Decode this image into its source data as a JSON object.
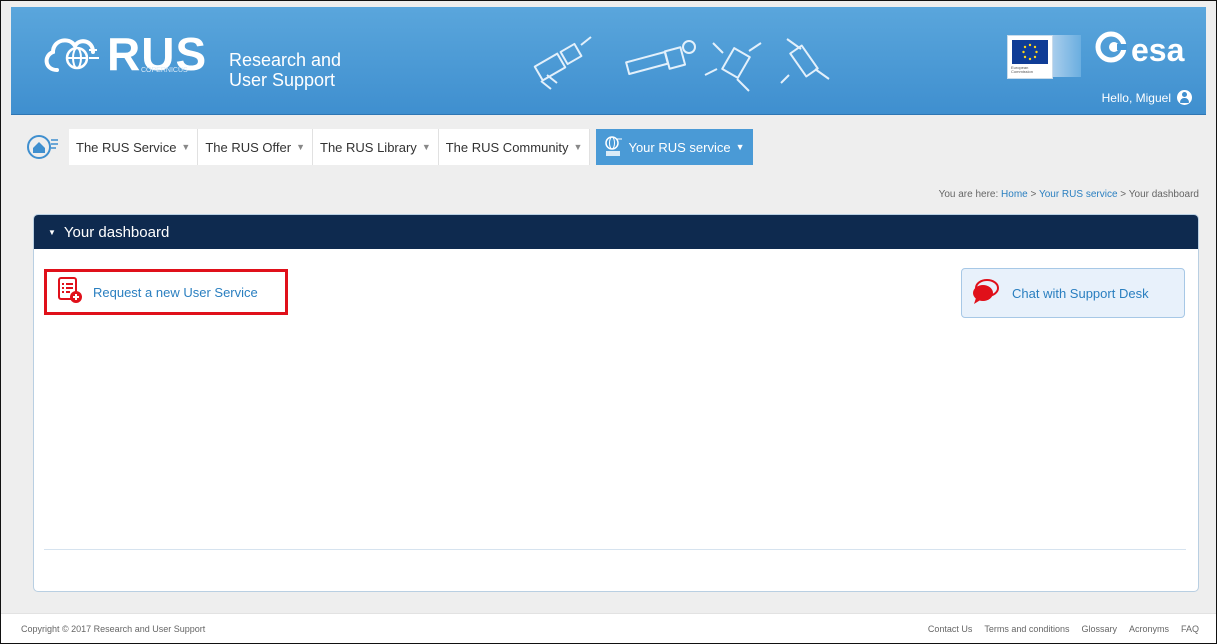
{
  "header": {
    "brand": "RUS",
    "brand_sub": "COPERNICUS",
    "tagline_line1": "Research and",
    "tagline_line2": "User Support",
    "eu_caption_1": "European",
    "eu_caption_2": "Commission",
    "partner_logo": "esa",
    "greeting": "Hello, Miguel",
    "colors": {
      "banner": "#4798d6",
      "nav_active": "#4a9ad6",
      "panel_head": "#0e2a4f"
    }
  },
  "nav": {
    "items": [
      {
        "label": "The RUS Service"
      },
      {
        "label": "The RUS Offer"
      },
      {
        "label": "The RUS Library"
      },
      {
        "label": "The RUS Community"
      }
    ],
    "active": {
      "label": "Your RUS service"
    },
    "caret": "▼"
  },
  "breadcrumb": {
    "prefix": "You are here:",
    "home": "Home",
    "sep": ">",
    "section": "Your RUS service",
    "current": "Your dashboard"
  },
  "dashboard": {
    "title": "Your dashboard",
    "request_label": "Request a new User Service",
    "chat_label": "Chat with Support Desk"
  },
  "footer": {
    "copyright": "Copyright © 2017 Research and User Support",
    "links": [
      "Contact Us",
      "Terms and conditions",
      "Glossary",
      "Acronyms",
      "FAQ"
    ]
  }
}
